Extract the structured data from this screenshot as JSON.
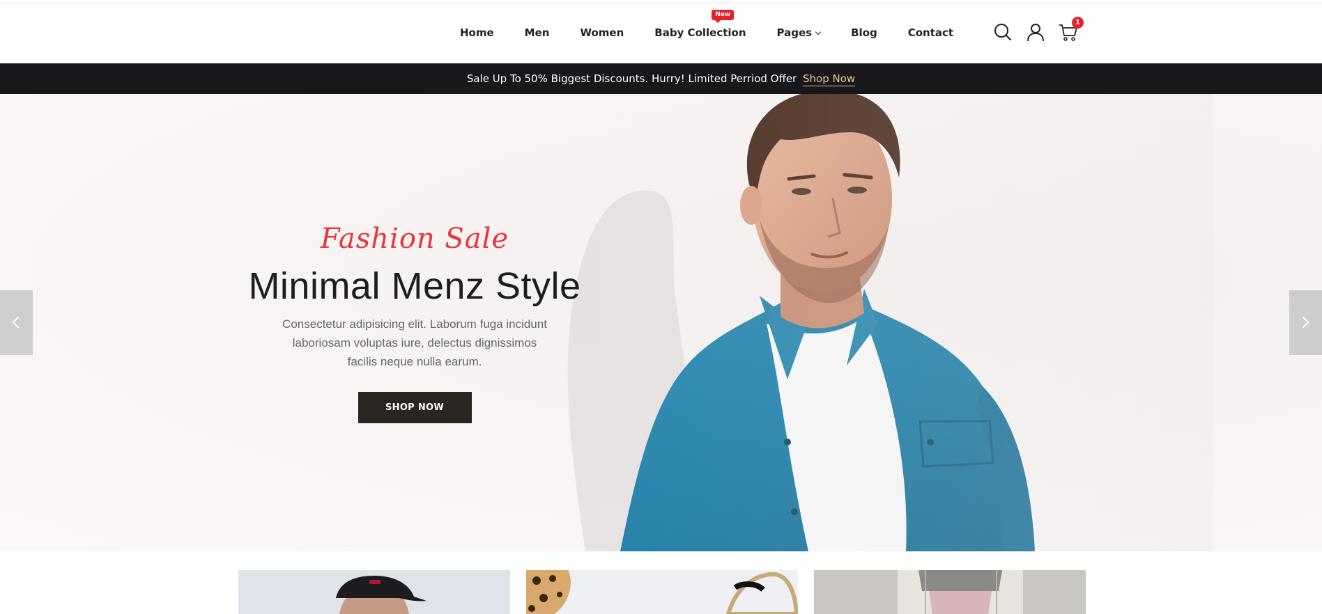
{
  "nav": {
    "items": [
      {
        "label": "Home"
      },
      {
        "label": "Men"
      },
      {
        "label": "Women"
      },
      {
        "label": "Baby Collection",
        "badge": "New"
      },
      {
        "label": "Pages"
      },
      {
        "label": "Blog"
      },
      {
        "label": "Contact"
      }
    ]
  },
  "header_icons": {
    "search": "search-icon",
    "account": "user-icon",
    "cart": "cart-icon",
    "cart_count": "1"
  },
  "announcement": {
    "text": "Sale Up To 50% Biggest Discounts. Hurry! Limited Perriod Offer",
    "link": "Shop Now"
  },
  "hero": {
    "subtitle": "Fashion Sale",
    "title": "Minimal Menz Style",
    "description": "Consectetur adipisicing elit. Laborum fuga incidunt laboriosam voluptas iure, delectus dignissimos facilis neque nulla earum.",
    "button": "SHOP NOW"
  },
  "colors": {
    "accent_red": "#e8202a",
    "announce_bg": "#17171c",
    "announce_link": "#f3c98b",
    "button_bg": "#2a2521"
  }
}
